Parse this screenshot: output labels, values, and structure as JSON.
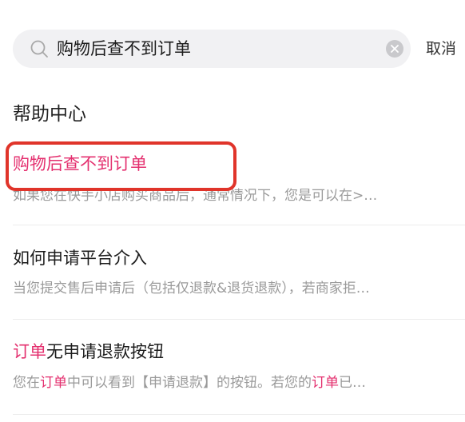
{
  "search": {
    "query": "购物后查不到订单",
    "cancel_label": "取消"
  },
  "section": {
    "title": "帮助中心"
  },
  "results": [
    {
      "title": "购物后查不到订单",
      "snippet": "如果您在快手小店购买商品后，通常情况下，您是可以在>…"
    },
    {
      "title": "如何申请平台介入",
      "snippet": "当您提交售后申请后（包括仅退款&退货退款），若商家拒…"
    },
    {
      "title_hl": "订单",
      "title_rest": "无申请退款按钮",
      "snippet_parts": [
        "您在",
        "订单",
        "中可以看到【申请退款】的按钮。若您的",
        "订单",
        "已…"
      ]
    }
  ],
  "colors": {
    "highlight": "#e4306f",
    "annotation_box": "#e0342a",
    "search_bg": "#f1f1f3"
  }
}
